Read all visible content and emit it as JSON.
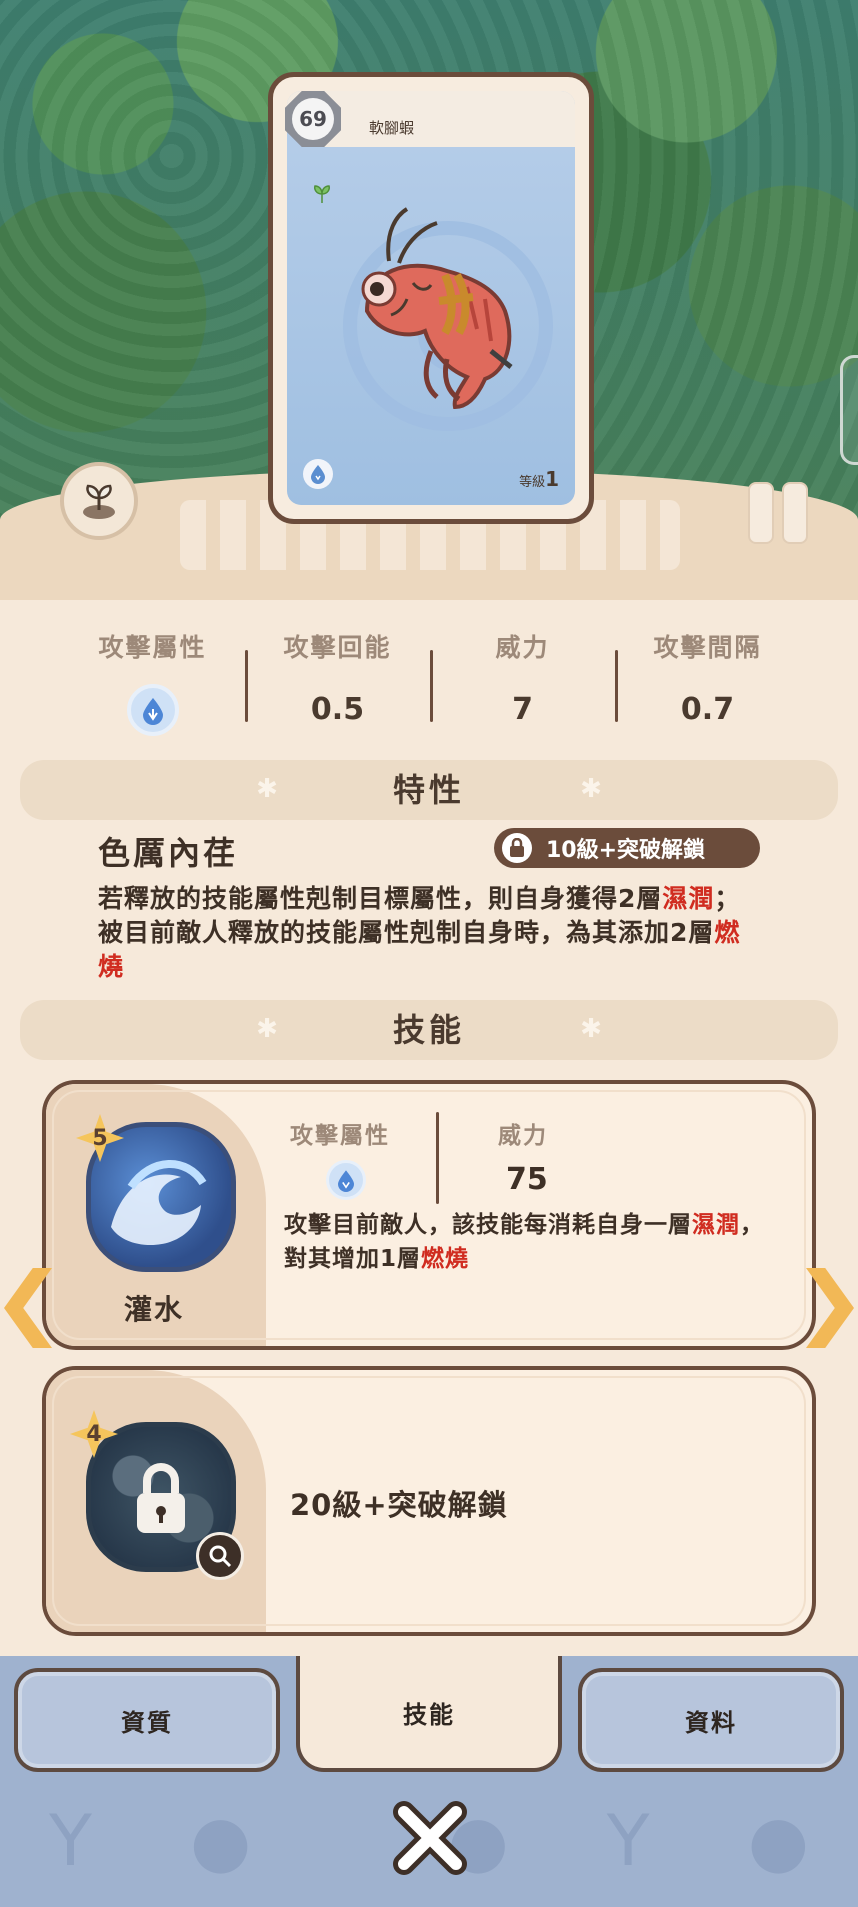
{
  "card": {
    "level_badge": "69",
    "name": "軟腳蝦",
    "level_label": "等級",
    "level_value": "1",
    "element_icon": "water-drop-icon",
    "type_icon": "sprout-icon"
  },
  "stats": {
    "attack_attr_label": "攻擊屬性",
    "attack_attr_icon": "water-drop-icon",
    "energy_label": "攻擊回能",
    "energy_value": "0.5",
    "power_label": "威力",
    "power_value": "7",
    "interval_label": "攻擊間隔",
    "interval_value": "0.7"
  },
  "trait_section": {
    "title": "特性",
    "name": "色厲內荏",
    "unlock_text": "10級+突破解鎖",
    "desc_part1": "若釋放的技能屬性剋制目標屬性，則自身獲得2層",
    "desc_red1": "濕潤",
    "desc_part2": "；被目前敵人釋放的技能屬性剋制自身時，為其添加2層",
    "desc_red2": "燃燒"
  },
  "skill_section": {
    "title": "技能",
    "skill1": {
      "badge": "5",
      "name": "灌水",
      "attr_label": "攻擊屬性",
      "attr_icon": "water-drop-icon",
      "power_label": "威力",
      "power_value": "75",
      "desc_part1": "攻擊目前敵人，該技能每消耗自身一層",
      "desc_red1": "濕潤",
      "desc_part2": "，對其增加1層",
      "desc_red2": "燃燒"
    },
    "skill2": {
      "badge": "4",
      "locked_text": "20級+突破解鎖"
    }
  },
  "tabs": {
    "aptitude": "資質",
    "skills": "技能",
    "info": "資料"
  },
  "colors": {
    "accent_red": "#d02c20",
    "border_brown": "#6b4c3b",
    "arrow_gold": "#f2b856",
    "panel": "#f6e9da"
  }
}
